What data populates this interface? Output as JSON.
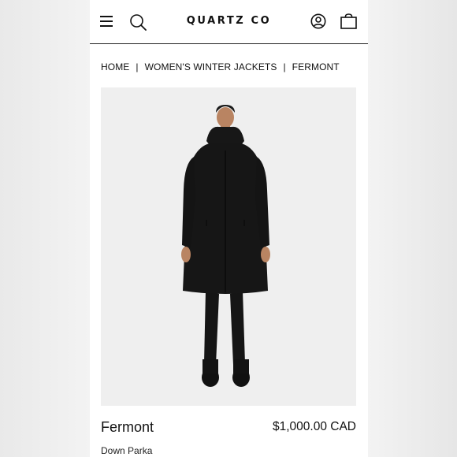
{
  "header": {
    "logo": "QUARTZ CO",
    "icons": [
      "menu-icon",
      "search-icon",
      "account-icon",
      "shopping-bag-icon"
    ]
  },
  "breadcrumb": {
    "items": [
      "HOME",
      "WOMEN'S WINTER JACKETS",
      "FERMONT"
    ],
    "separator": "|"
  },
  "product": {
    "image_alt": "Model wearing black Fermont down parka",
    "name": "Fermont",
    "price": "$1,000.00 CAD",
    "subtitle": "Down Parka"
  },
  "colors": {
    "background": "#ffffff",
    "image_background": "#efefef",
    "text": "#111111",
    "parka": "#161616"
  }
}
